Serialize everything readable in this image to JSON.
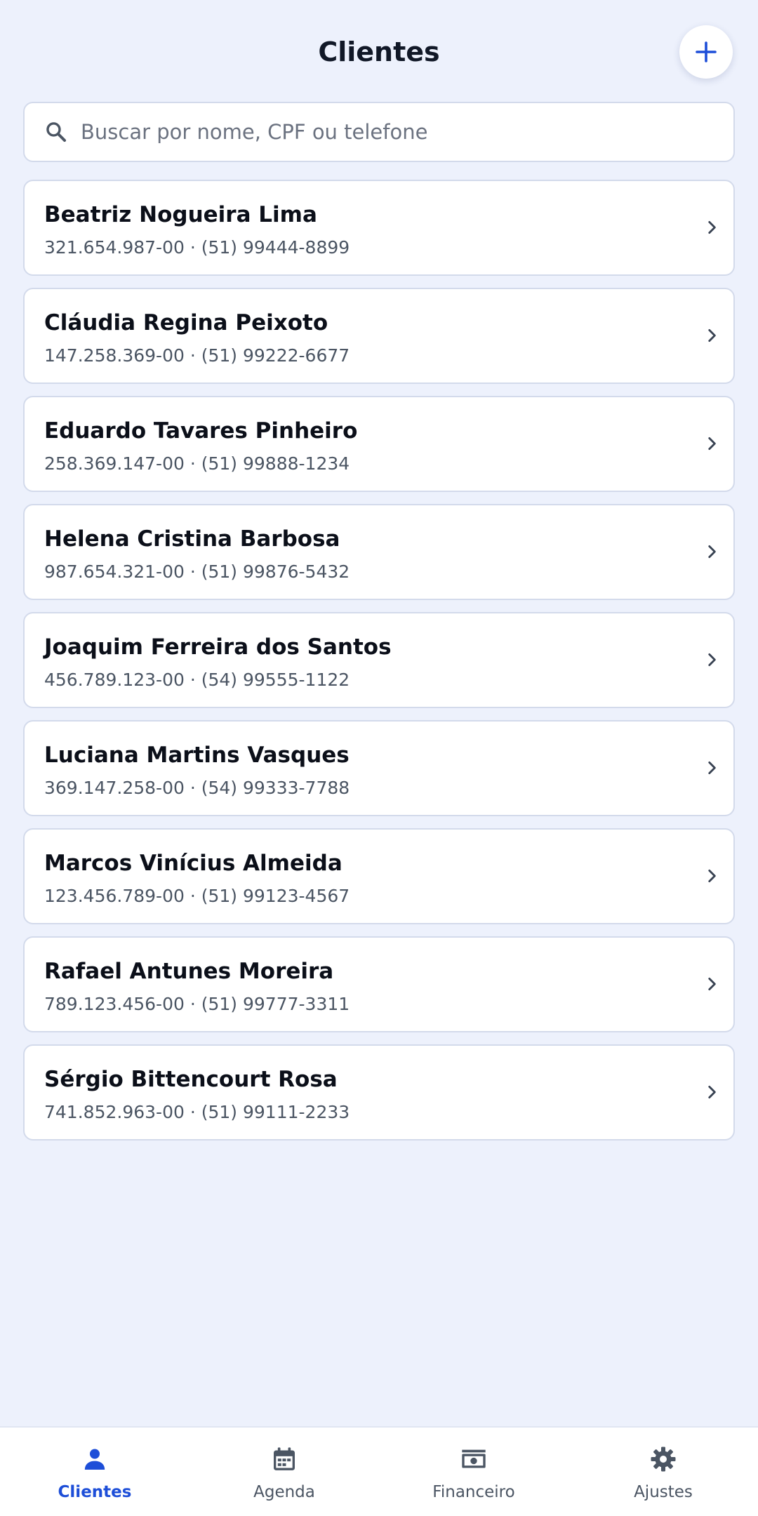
{
  "header": {
    "title": "Clientes",
    "add_icon": "plus-icon"
  },
  "search": {
    "placeholder": "Buscar por nome, CPF ou telefone",
    "value": "",
    "icon": "search-icon"
  },
  "clients": [
    {
      "name": "Beatriz Nogueira Lima",
      "info": "321.654.987-00 · (51) 99444-8899"
    },
    {
      "name": "Cláudia Regina Peixoto",
      "info": "147.258.369-00 · (51) 99222-6677"
    },
    {
      "name": "Eduardo Tavares Pinheiro",
      "info": "258.369.147-00 · (51) 99888-1234"
    },
    {
      "name": "Helena Cristina Barbosa",
      "info": "987.654.321-00 · (51) 99876-5432"
    },
    {
      "name": "Joaquim Ferreira dos Santos",
      "info": "456.789.123-00 · (54) 99555-1122"
    },
    {
      "name": "Luciana Martins Vasques",
      "info": "369.147.258-00 · (54) 99333-7788"
    },
    {
      "name": "Marcos Vinícius Almeida",
      "info": "123.456.789-00 · (51) 99123-4567"
    },
    {
      "name": "Rafael Antunes Moreira",
      "info": "789.123.456-00 · (51) 99777-3311"
    },
    {
      "name": "Sérgio Bittencourt Rosa",
      "info": "741.852.963-00 · (51) 99111-2233"
    }
  ],
  "bottom_nav": {
    "items": [
      {
        "label": "Clientes",
        "icon": "person-icon",
        "active": true
      },
      {
        "label": "Agenda",
        "icon": "calendar-icon",
        "active": false
      },
      {
        "label": "Financeiro",
        "icon": "money-icon",
        "active": false
      },
      {
        "label": "Ajustes",
        "icon": "gear-icon",
        "active": false
      }
    ]
  },
  "colors": {
    "background": "#edf1fc",
    "accent": "#1d4ed8",
    "card": "#ffffff",
    "border": "#d3daeb",
    "title": "#111827",
    "secondary_text": "#4b5563"
  }
}
